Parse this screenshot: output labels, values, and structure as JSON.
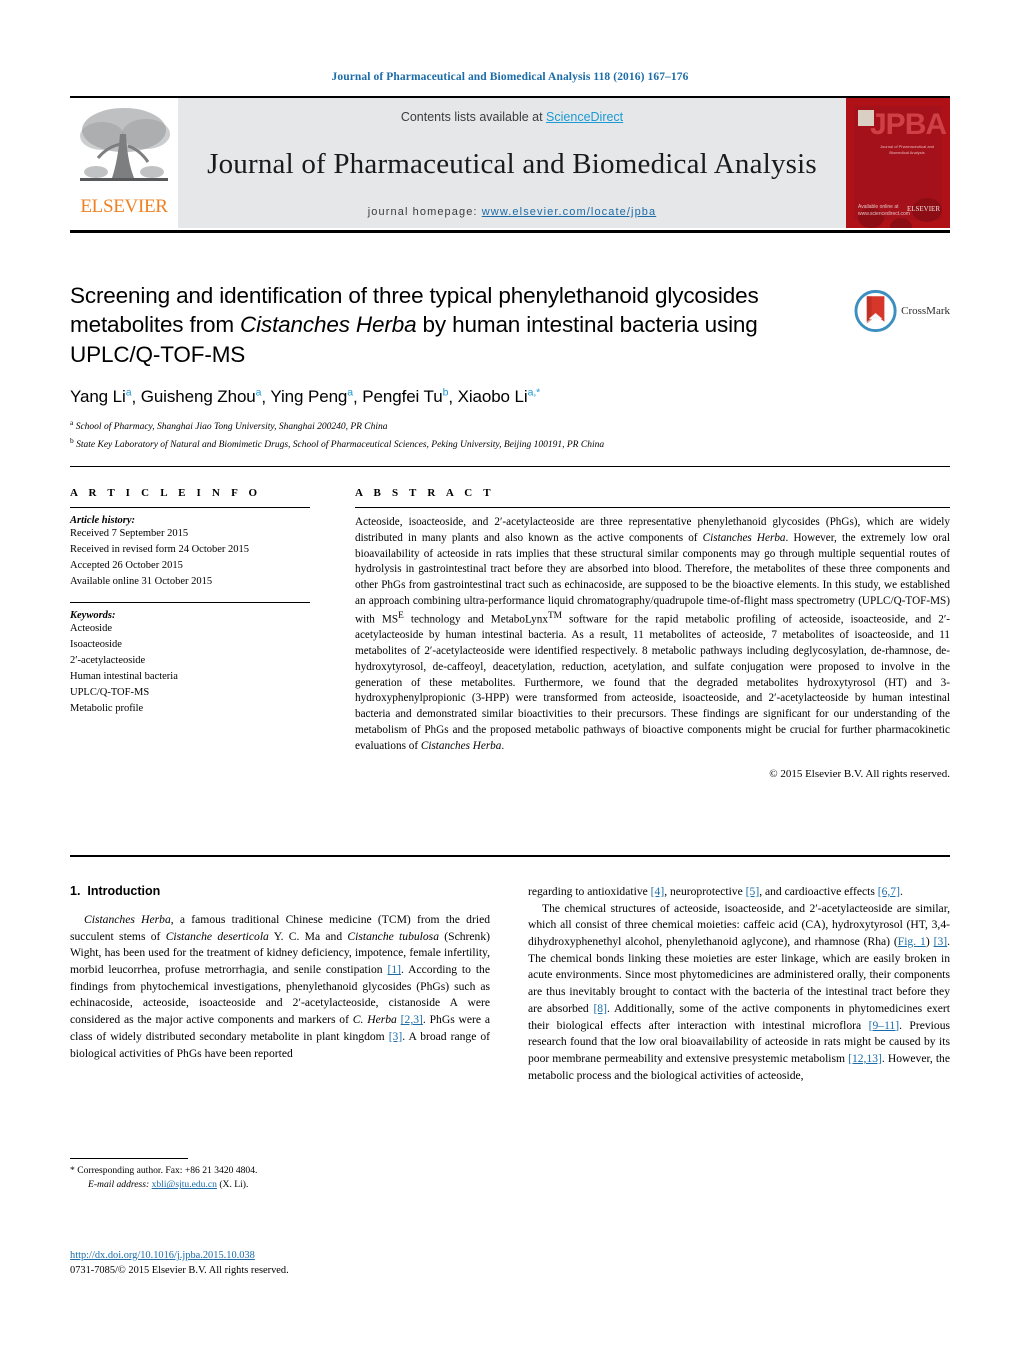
{
  "running_head": "Journal of Pharmaceutical and Biomedical Analysis 118 (2016) 167–176",
  "masthead": {
    "contents_prefix": "Contents lists available at ",
    "sciencedirect": "ScienceDirect",
    "journal_title": "Journal of Pharmaceutical and Biomedical Analysis",
    "homepage_prefix": "journal homepage: ",
    "homepage_url": "www.elsevier.com/locate/jpba",
    "elsevier_wordmark": "ELSEVIER",
    "cover": {
      "acronym": "JPBA",
      "subtitle": "Journal of Pharmaceutical and Biomedical Analysis",
      "footer": "Available online at\nwww.sciencedirect.com",
      "publisher": "ELSEVIER"
    },
    "accent_link_color": "#1b9ad6",
    "elsevier_orange": "#f08122",
    "cover_red": "#b01116"
  },
  "article": {
    "title_part1": "Screening and identification of three typical phenylethanoid glycosides metabolites from ",
    "title_italic": "Cistanches Herba",
    "title_part2": " by human intestinal bacteria using UPLC/Q-TOF-MS",
    "crossmark_label": "CrossMark",
    "authors": [
      {
        "name": "Yang Li",
        "sup": "a"
      },
      {
        "name": "Guisheng Zhou",
        "sup": "a"
      },
      {
        "name": "Ying Peng",
        "sup": "a"
      },
      {
        "name": "Pengfei Tu",
        "sup": "b"
      },
      {
        "name": "Xiaobo Li",
        "sup": "a,*"
      }
    ],
    "affiliations": [
      {
        "marker": "a",
        "text": "School of Pharmacy, Shanghai Jiao Tong University, Shanghai 200240, PR China"
      },
      {
        "marker": "b",
        "text": "State Key Laboratory of Natural and Biomimetic Drugs, School of Pharmaceutical Sciences, Peking University, Beijing 100191, PR China"
      }
    ]
  },
  "article_info": {
    "heading": "A R T I C L E   I N F O",
    "history_label": "Article history:",
    "history": [
      "Received 7 September 2015",
      "Received in revised form 24 October 2015",
      "Accepted 26 October 2015",
      "Available online 31 October 2015"
    ],
    "keywords_label": "Keywords:",
    "keywords": [
      "Acteoside",
      "Isoacteoside",
      "2′-acetylacteoside",
      "Human intestinal bacteria",
      "UPLC/Q-TOF-MS",
      "Metabolic profile"
    ]
  },
  "abstract": {
    "heading": "A B S T R A C T",
    "paragraph_1": "Acteoside, isoacteoside, and 2′-acetylacteoside are three representative phenylethanoid glycosides (PhGs), which are widely distributed in many plants and also known as the active components of ",
    "italic_1": "Cistanches Herba",
    "paragraph_2": ". However, the extremely low oral bioavailability of acteoside in rats implies that these structural similar components may go through multiple sequential routes of hydrolysis in gastrointestinal tract before they are absorbed into blood. Therefore, the metabolites of these three components and other PhGs from gastrointestinal tract such as echinacoside, are supposed to be the bioactive elements. In this study, we established an approach combining ultra-performance liquid chromatography/quadrupole time-of-flight mass spectrometry (UPLC/Q-TOF-MS) with MS",
    "sup_e": "E",
    "paragraph_3": " technology and MetaboLynx",
    "sup_tm": "TM",
    "paragraph_4": " software for the rapid metabolic profiling of acteoside, isoacteoside, and 2′-acetylacteoside by human intestinal bacteria. As a result, 11 metabolites of acteoside, 7 metabolites of isoacteoside, and 11 metabolites of 2′-acetylacteoside were identified respectively. 8 metabolic pathways including deglycosylation, de-rhamnose, de-hydroxytyrosol, de-caffeoyl, deacetylation, reduction, acetylation, and sulfate conjugation were proposed to involve in the generation of these metabolites. Furthermore, we found that the degraded metabolites hydroxytyrosol (HT) and 3-hydroxyphenylpropionic (3-HPP) were transformed from acteoside, isoacteoside, and 2′-acetylacteoside by human intestinal bacteria and demonstrated similar bioactivities to their precursors. These findings are significant for our understanding of the metabolism of PhGs and the proposed metabolic pathways of bioactive components might be crucial for further pharmacokinetic evaluations of ",
    "italic_2": "Cistanches Herba",
    "paragraph_5": ".",
    "copyright": "© 2015 Elsevier B.V. All rights reserved."
  },
  "introduction": {
    "section_number": "1.",
    "section_title": "Introduction",
    "left_column": {
      "p1_italic_lead": "Cistanches Herba",
      "p1_a": ", a famous traditional Chinese medicine (TCM) from the dried succulent stems of ",
      "p1_italic_b": "Cistanche deserticola",
      "p1_c": " Y. C. Ma and ",
      "p1_italic_d": "Cistanche tubulosa",
      "p1_e": " (Schrenk) Wight, has been used for the treatment of kidney deficiency, impotence, female infertility, morbid leucorrhea, profuse metrorrhagia, and senile constipation ",
      "ref1": "[1]",
      "p1_f": ". According to the findings from phytochemical investigations, phenylethanoid glycosides (PhGs) such as echinacoside, acteoside, isoacteoside and 2′-acetylacteoside, cistanoside A were considered as the major active components and markers of ",
      "p1_italic_g": "C. Herba",
      "p1_h": " ",
      "ref2": "[2,3]",
      "p1_i": ". PhGs were a class of widely distributed secondary metabolite in plant kingdom ",
      "ref3": "[3]",
      "p1_j": ". A broad range of biological activities of PhGs have been reported"
    },
    "right_column": {
      "p1_a": "regarding to antioxidative ",
      "ref4": "[4]",
      "p1_b": ", neuroprotective ",
      "ref5": "[5]",
      "p1_c": ", and cardioactive effects ",
      "ref67": "[6,7]",
      "p1_d": ".",
      "p2_a": "The chemical structures of acteoside, isoacteoside, and 2′-acetylacteoside are similar, which all consist of three chemical moieties: caffeic acid (CA), hydroxytyrosol (HT, 3,4-dihydroxyphenethyl alcohol, phenylethanoid aglycone), and rhamnose (Rha) (",
      "figref": "Fig. 1",
      "p2_b": ") ",
      "ref3b": "[3]",
      "p2_c": ". The chemical bonds linking these moieties are ester linkage, which are easily broken in acute environments. Since most phytomedicines are administered orally, their components are thus inevitably brought to contact with the bacteria of the intestinal tract before they are absorbed ",
      "ref8": "[8]",
      "p2_d": ". Additionally, some of the active components in phytomedicines exert their biological effects after interaction with intestinal microflora ",
      "ref911": "[9–11]",
      "p2_e": ". Previous research found that the low oral bioavailability of acteoside in rats might be caused by its poor membrane permeability and extensive presystemic metabolism ",
      "ref1213": "[12,13]",
      "p2_f": ". However, the metabolic process and the biological activities of acteoside,"
    }
  },
  "footnote": {
    "corresponding_marker": "*",
    "corresponding": " Corresponding author. Fax: +86 21 3420 4804.",
    "email_label": "E-mail address:",
    "email": "xbli@sjtu.edu.cn",
    "email_suffix": " (X. Li)."
  },
  "footer": {
    "doi": "http://dx.doi.org/10.1016/j.jpba.2015.10.038",
    "issn_line": "0731-7085/© 2015 Elsevier B.V. All rights reserved."
  }
}
